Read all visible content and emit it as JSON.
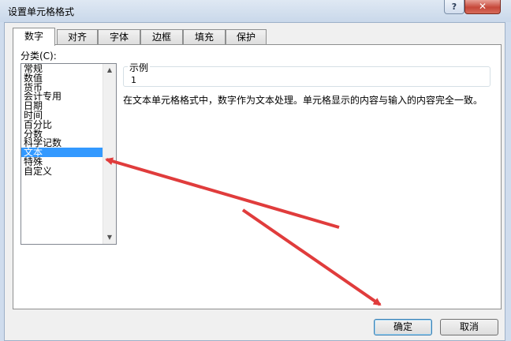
{
  "window": {
    "title": "设置单元格格式",
    "help_glyph": "?",
    "close_glyph": "✕"
  },
  "tabs": [
    {
      "label": "数字",
      "active": true
    },
    {
      "label": "对齐"
    },
    {
      "label": "字体"
    },
    {
      "label": "边框"
    },
    {
      "label": "填充"
    },
    {
      "label": "保护"
    }
  ],
  "category": {
    "label": "分类(C):",
    "items": [
      "常规",
      "数值",
      "货币",
      "会计专用",
      "日期",
      "时间",
      "百分比",
      "分数",
      "科学记数",
      "文本",
      "特殊",
      "自定义"
    ],
    "selected_index": 9
  },
  "sample": {
    "label": "示例",
    "value": "1"
  },
  "description": "在文本单元格格式中，数字作为文本处理。单元格显示的内容与输入的内容完全一致。",
  "buttons": {
    "ok": "确定",
    "cancel": "取消"
  },
  "colors": {
    "selection": "#3399ff",
    "annotation_arrow": "#e03c3c"
  }
}
